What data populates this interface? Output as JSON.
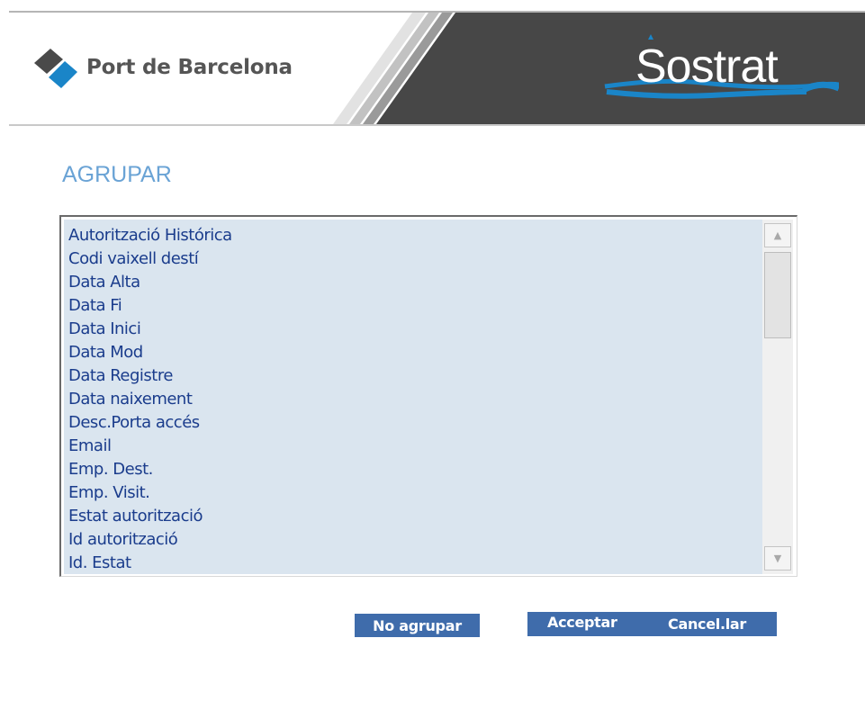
{
  "header": {
    "brand_name": "Port de Barcelona",
    "app_logo_text": "Sostrat",
    "brand_color": "#1a85c8",
    "header_dark_color": "#474747"
  },
  "page": {
    "title": "AGRUPAR",
    "title_color": "#6aa3d5"
  },
  "list": {
    "selected_bg": "#dae5ef",
    "text_color": "#1a3c8c",
    "items": [
      {
        "label": "Autorització Histórica"
      },
      {
        "label": "Codi vaixell destí"
      },
      {
        "label": "Data Alta"
      },
      {
        "label": "Data Fi"
      },
      {
        "label": "Data Inici"
      },
      {
        "label": "Data Mod"
      },
      {
        "label": "Data Registre"
      },
      {
        "label": "Data naixement"
      },
      {
        "label": "Desc.Porta accés"
      },
      {
        "label": "Email"
      },
      {
        "label": "Emp. Dest."
      },
      {
        "label": "Emp. Visit."
      },
      {
        "label": "Estat autorització"
      },
      {
        "label": "Id autorització"
      },
      {
        "label": "Id. Estat"
      }
    ]
  },
  "buttons": {
    "no_agrupar": "No agrupar",
    "acceptar": "Acceptar",
    "cancelar": "Cancel.lar",
    "color": "#3f6cab"
  }
}
